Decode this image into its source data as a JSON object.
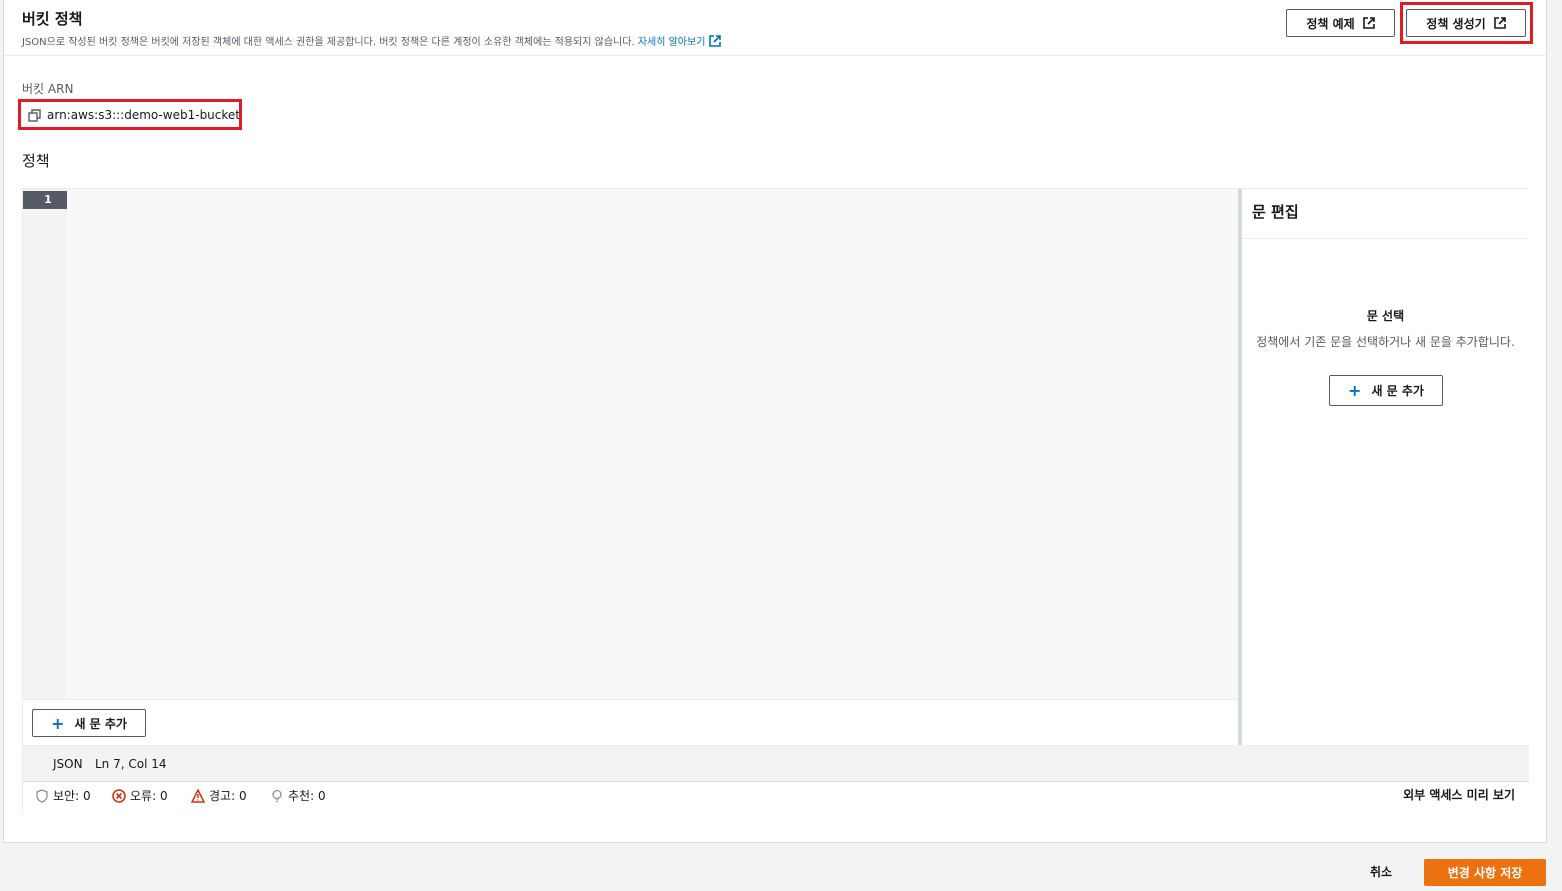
{
  "header": {
    "title": "버킷 정책",
    "description": "JSON으로 작성된 버킷 정책은 버킷에 저장된 객체에 대한 액세스 권한을 제공합니다. 버킷 정책은 다른 계정이 소유한 객체에는 적용되지 않습니다.",
    "learn_more": "자세히 알아보기",
    "policy_examples_button": "정책 예제",
    "policy_generator_button": "정책 생성기"
  },
  "arn": {
    "label": "버킷 ARN",
    "value": "arn:aws:s3:::demo-web1-bucket"
  },
  "policy": {
    "title": "정책",
    "line_number": "1",
    "add_statement_button": "새 문 추가"
  },
  "side_panel": {
    "title": "문 편집",
    "heading": "문 선택",
    "text": "정책에서 기존 문을 선택하거나 새 문을 추가합니다.",
    "add_statement_button": "새 문 추가"
  },
  "status_bar": {
    "language": "JSON",
    "position": "Ln 7, Col 14"
  },
  "issues": {
    "security": "보안: 0",
    "errors": "오류: 0",
    "warnings": "경고: 0",
    "suggestions": "추천: 0",
    "preview_external_access": "외부 액세스 미리 보기"
  },
  "footer": {
    "cancel": "취소",
    "save": "변경 사항 저장"
  },
  "colors": {
    "accent": "#ec7211",
    "link": "#0073bb",
    "highlight": "#e01b24"
  }
}
